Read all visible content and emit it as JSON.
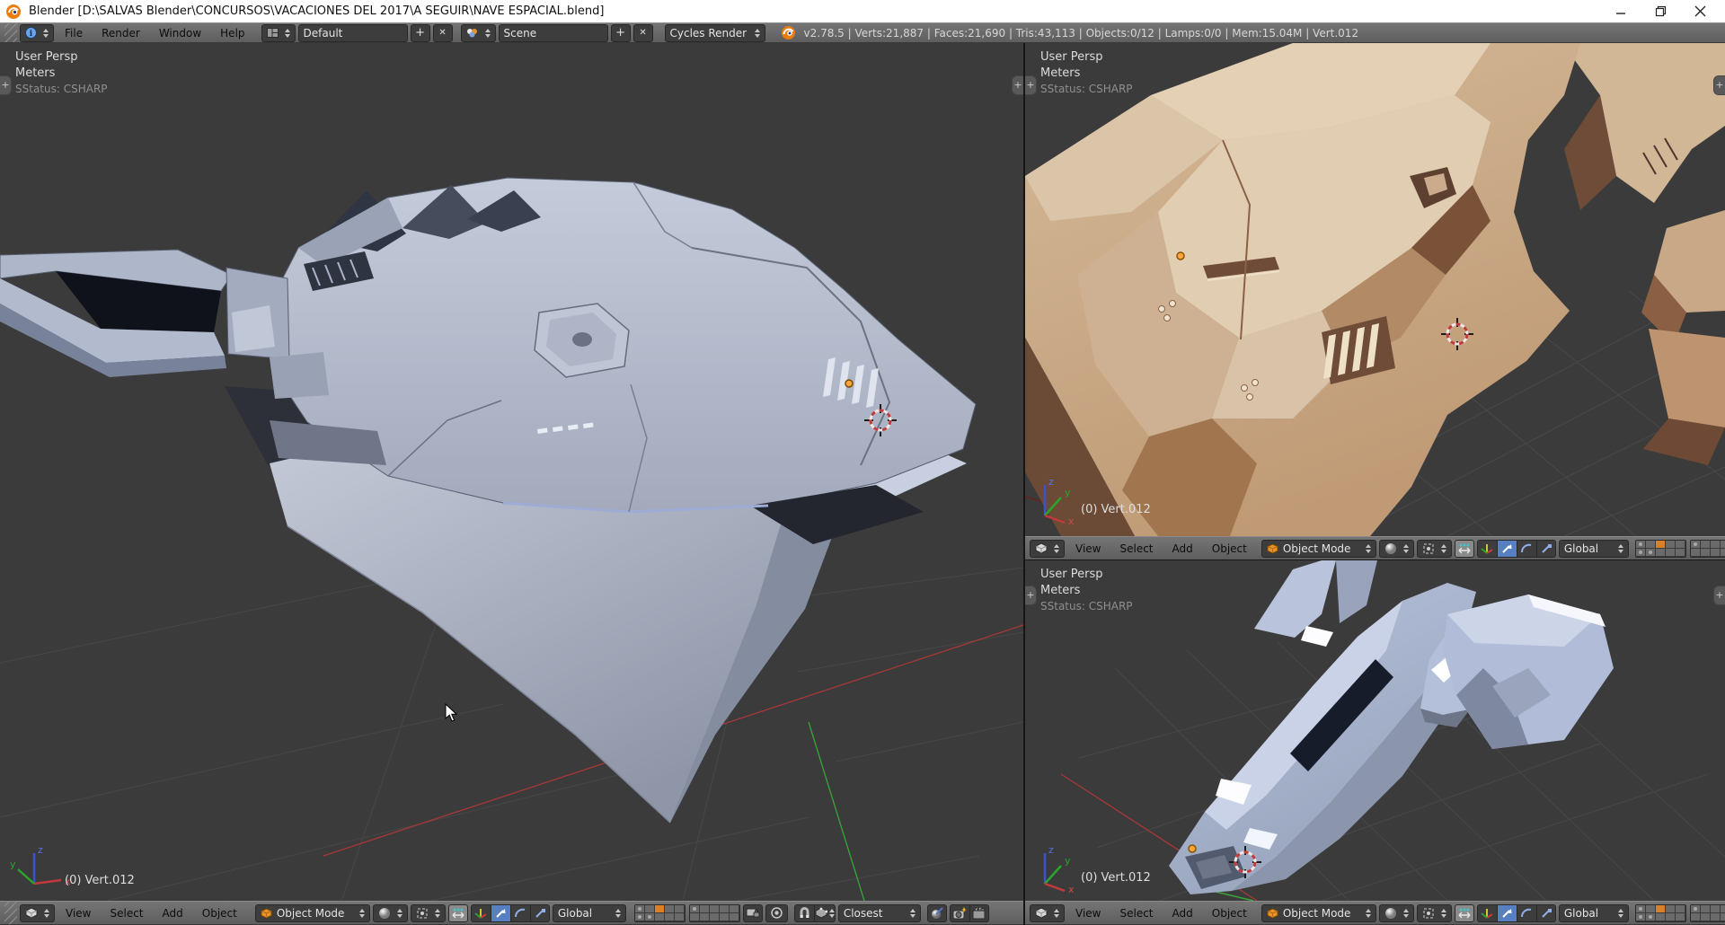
{
  "window": {
    "title": "Blender [D:\\SALVAS Blender\\CONCURSOS\\VACACIONES DEL 2017\\A SEGUIR\\NAVE ESPACIAL.blend]"
  },
  "topbar": {
    "menus": [
      "File",
      "Render",
      "Window",
      "Help"
    ],
    "layout": {
      "value": "Default",
      "add_label": "+",
      "close_label": "✕"
    },
    "scene": {
      "value": "Scene",
      "add_label": "+",
      "close_label": "✕"
    },
    "engine": {
      "value": "Cycles Render"
    },
    "stats": "v2.78.5 | Verts:21,887 | Faces:21,690 | Tris:43,113 | Objects:0/12 | Lamps:0/0 | Mem:15.04M | Vert.012"
  },
  "viewport_overlay": {
    "projection": "User Persp",
    "unit": "Meters",
    "sstatus": "SStatus: CSHARP",
    "object_info": "(0) Vert.012"
  },
  "viewport_header": {
    "menus": [
      "View",
      "Select",
      "Add",
      "Object"
    ],
    "mode": "Object Mode",
    "orientation": "Global",
    "snap_target": "Closest"
  },
  "axis_gizmo": {
    "x": "x",
    "y": "y",
    "z": "z"
  },
  "colors": {
    "accent_orange": "#e87d0d",
    "layer_active_orange": "#d8812a",
    "selected_blue": "#5680c2",
    "viewport_bg": "#3b3b3b",
    "header_bg": "#676767",
    "widget_bg": "#3d3d3d",
    "ship_gray_blue": "#b6bdcc",
    "ship_clay_tan": "#c9aa8a",
    "axis_x_red": "#a83838",
    "axis_y_green": "#3aa33a",
    "axis_z_blue": "#3c54c8"
  }
}
